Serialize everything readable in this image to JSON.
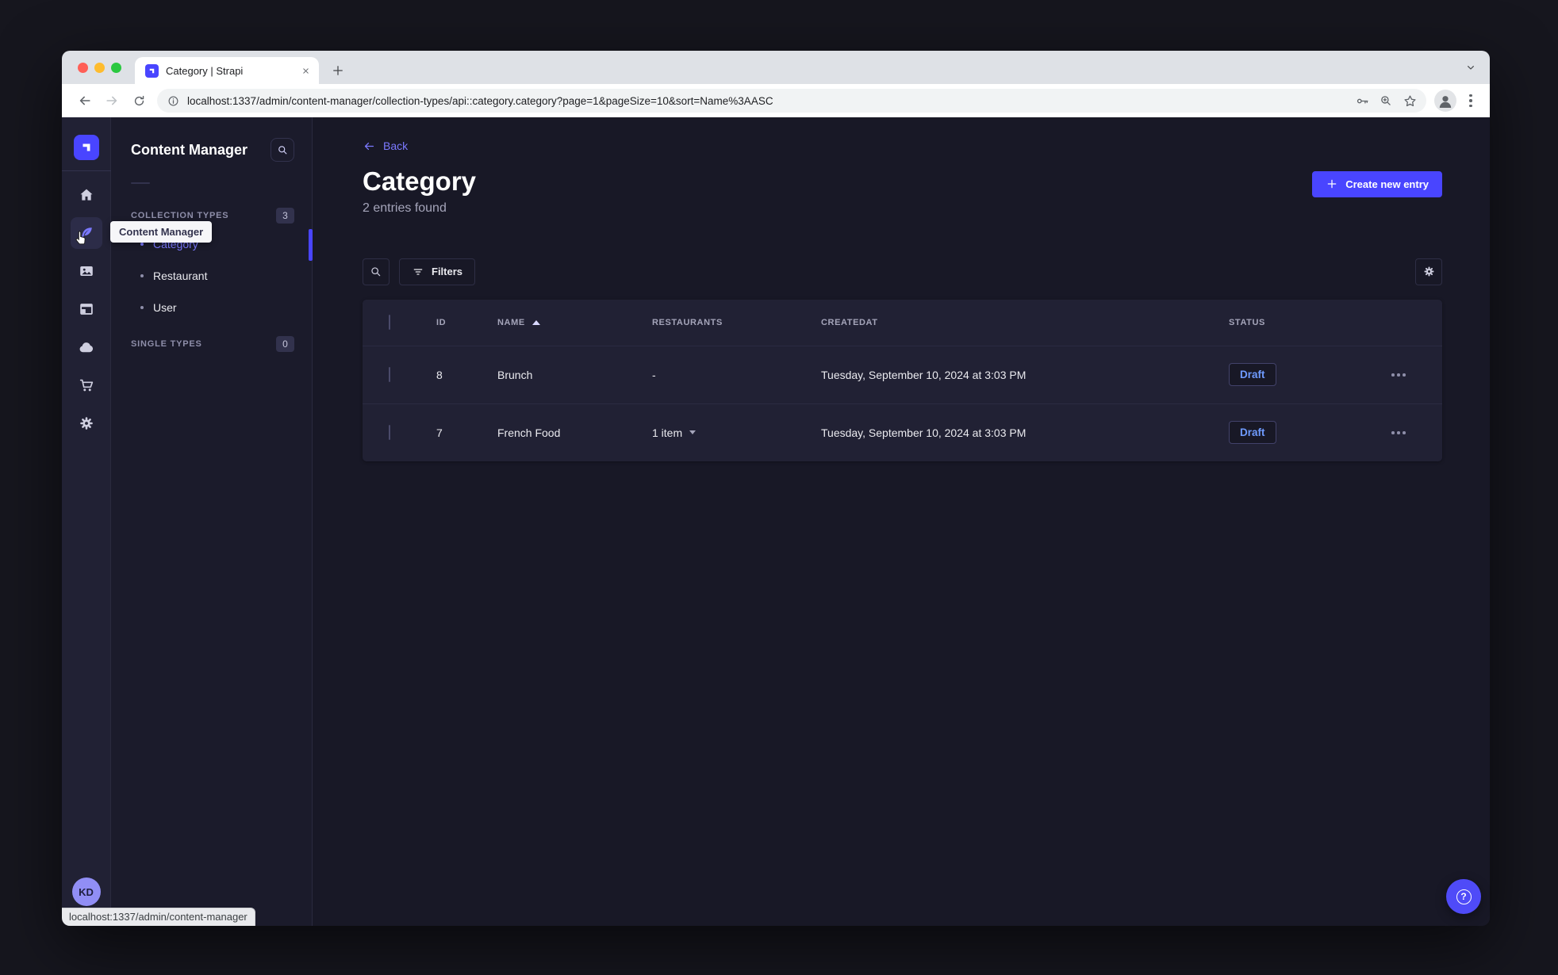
{
  "browser": {
    "tab_title": "Category | Strapi",
    "url": "localhost:1337/admin/content-manager/collection-types/api::category.category?page=1&pageSize=10&sort=Name%3AASC",
    "status_tooltip": "localhost:1337/admin/content-manager"
  },
  "sidebar": {
    "avatar": "KD",
    "tooltip": "Content Manager"
  },
  "subnav": {
    "title": "Content Manager",
    "collection_types": {
      "label": "COLLECTION TYPES",
      "count": "3",
      "items": [
        {
          "label": "Category",
          "active": true
        },
        {
          "label": "Restaurant",
          "active": false
        },
        {
          "label": "User",
          "active": false
        }
      ]
    },
    "single_types": {
      "label": "SINGLE TYPES",
      "count": "0"
    }
  },
  "main": {
    "back": "Back",
    "title": "Category",
    "subtitle": "2 entries found",
    "create_button": "Create new entry",
    "filters_button": "Filters",
    "table": {
      "headers": {
        "id": "ID",
        "name": "NAME",
        "restaurants": "RESTAURANTS",
        "createdat": "CREATEDAT",
        "status": "STATUS"
      },
      "rows": [
        {
          "id": "8",
          "name": "Brunch",
          "restaurants": "-",
          "createdat": "Tuesday, September 10, 2024 at 3:03 PM",
          "status": "Draft"
        },
        {
          "id": "7",
          "name": "French Food",
          "restaurants": "1 item",
          "createdat": "Tuesday, September 10, 2024 at 3:03 PM",
          "status": "Draft"
        }
      ]
    }
  },
  "icons": {
    "help": "?"
  },
  "colors": {
    "primary": "#4945ff",
    "link": "#7b79ff",
    "draft_text": "#6f9bff",
    "app_background": "#181826",
    "panel_background": "#212134"
  }
}
